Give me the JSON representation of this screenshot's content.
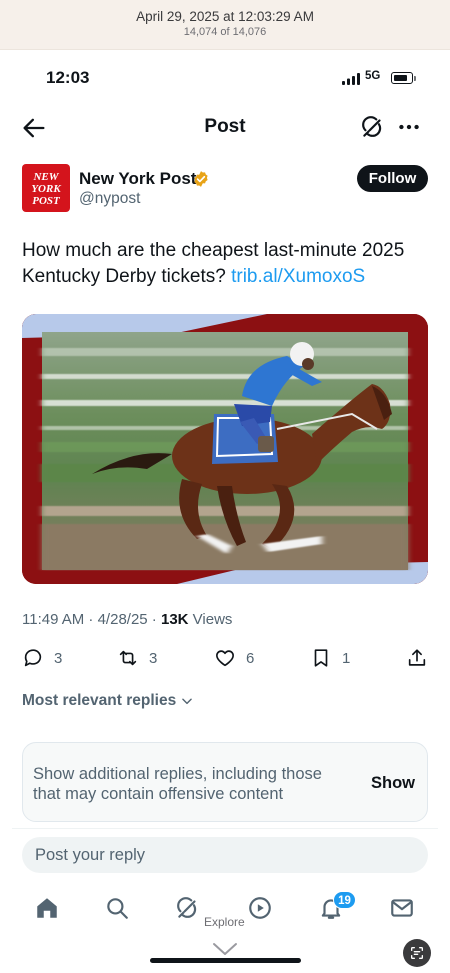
{
  "photos_viewer": {
    "date": "April 29, 2025 at 12:03:29 AM",
    "counter": "14,074 of 14,076"
  },
  "status_bar": {
    "time": "12:03",
    "network": "5G",
    "signal_icon": "cellular-signal-icon",
    "battery_icon": "battery-icon"
  },
  "nav": {
    "title": "Post",
    "back_icon": "back-arrow-icon",
    "grok_icon": "grok-icon",
    "more_icon": "more-dots-icon"
  },
  "author": {
    "name": "New York Post",
    "handle": "@nypost",
    "verified_icon": "gold-verified-badge-icon",
    "avatar_text": [
      "NEW",
      "YORK",
      "POST"
    ],
    "follow_label": "Follow"
  },
  "tweet": {
    "text": "How much are the cheapest last-minute 2025 Kentucky Derby tickets? ",
    "link": "trib.al/XumoxoS",
    "media_icon": "horse-racing-photo"
  },
  "meta": {
    "time_date": "11:49 AM · 4/28/25 · ",
    "views_count": "13K",
    "views_label": " Views"
  },
  "actions": [
    {
      "name": "reply",
      "icon": "reply-icon",
      "count": "3"
    },
    {
      "name": "repost",
      "icon": "repost-icon",
      "count": "3"
    },
    {
      "name": "like",
      "icon": "heart-icon",
      "count": "6"
    },
    {
      "name": "bookmark",
      "icon": "bookmark-icon",
      "count": "1"
    },
    {
      "name": "share",
      "icon": "share-icon",
      "count": ""
    }
  ],
  "replies": {
    "sort_label": "Most relevant replies",
    "notice_text": "Show additional replies, including those that may contain offensive content",
    "show_label": "Show",
    "reply_placeholder": "Post your reply"
  },
  "tabbar": {
    "items": [
      "home-icon",
      "search-icon",
      "grok-icon",
      "video-icon",
      "notifications-icon",
      "messages-icon"
    ],
    "notif_count": "19",
    "explore_tooltip": "Explore"
  },
  "colors": {
    "brand_red": "#d4141c",
    "link_blue": "#1d9bf0",
    "text_primary": "#0f1419",
    "text_secondary": "#536471",
    "verified_gold": "#e8a317"
  }
}
